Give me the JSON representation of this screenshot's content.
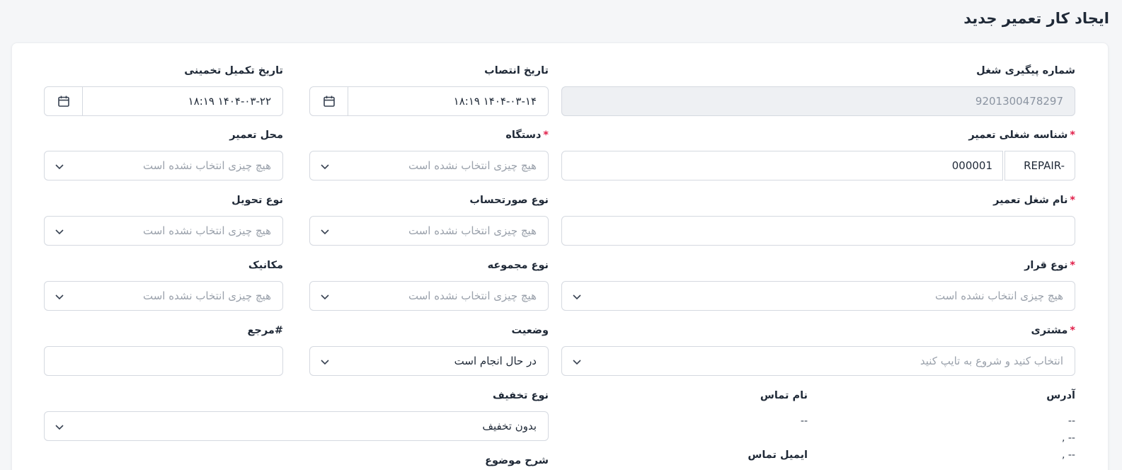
{
  "page": {
    "title": "ایجاد کار تعمیر جدید"
  },
  "form": {
    "tracking_number": {
      "label": "شماره پیگیری شغل",
      "value": "9201300478297"
    },
    "assign_date": {
      "label": "تاریخ انتصاب",
      "value": "۱۴۰۴-۰۳-۱۴ ۱۸:۱۹"
    },
    "estimated_completion": {
      "label": "تاریخ تکمیل تخمینی",
      "value": "۱۴۰۴-۰۳-۲۲ ۱۸:۱۹"
    },
    "repair_job_id": {
      "label": "شناسه شغلی تعمیر",
      "required": "*",
      "prefix": "REPAIR-",
      "value": "000001"
    },
    "device": {
      "label": "دستگاه",
      "required": "*",
      "placeholder": "هیچ چیزی انتخاب نشده است"
    },
    "repair_location": {
      "label": "محل تعمیر",
      "placeholder": "هیچ چیزی انتخاب نشده است"
    },
    "repair_job_name": {
      "label": "نام شغل تعمیر",
      "required": "*",
      "value": ""
    },
    "invoice_type": {
      "label": "نوع صورتحساب",
      "placeholder": "هیچ چیزی انتخاب نشده است"
    },
    "delivery_type": {
      "label": "نوع تحویل",
      "placeholder": "هیچ چیزی انتخاب نشده است"
    },
    "appointment_type": {
      "label": "نوع قرار",
      "required": "*",
      "placeholder": "هیچ چیزی انتخاب نشده است"
    },
    "set_type": {
      "label": "نوع مجموعه",
      "placeholder": "هیچ چیزی انتخاب نشده است"
    },
    "mechanic": {
      "label": "مکانیک",
      "placeholder": "هیچ چیزی انتخاب نشده است"
    },
    "customer": {
      "label": "مشتری",
      "required": "*",
      "placeholder": "انتخاب کنید و شروع به تایپ کنید"
    },
    "status": {
      "label": "وضعیت",
      "value": "در حال انجام است"
    },
    "reference": {
      "label": "#مرجع",
      "value": ""
    },
    "discount_type": {
      "label": "نوع تخفیف",
      "value": "بدون تخفیف"
    },
    "subject_description": {
      "label": "شرح موضوع"
    }
  },
  "customer_info": {
    "address_label": "آدرس",
    "address_line1": "--",
    "address_line2": "-- ,",
    "address_line3": "-- ,",
    "contact_name_label": "نام تماس",
    "contact_name_value": "--",
    "contact_email_label": "ایمیل تماس"
  },
  "icons": {
    "calendar": "calendar-icon",
    "chevron": "chevron-down-icon"
  }
}
